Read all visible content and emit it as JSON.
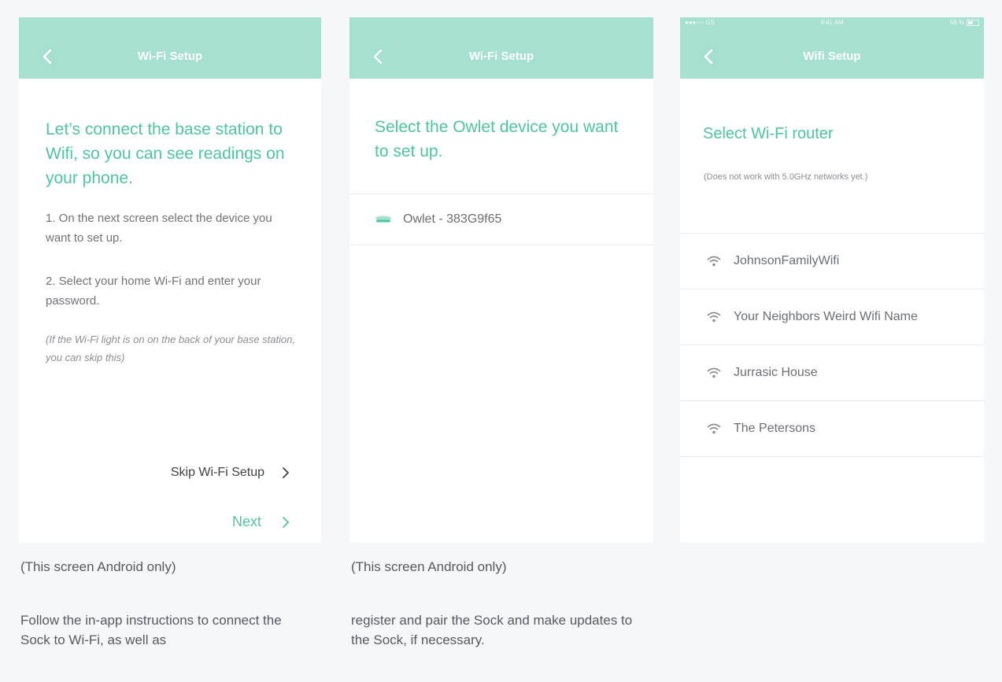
{
  "screens": [
    {
      "title": "Wi-Fi Setup",
      "heading": "Let’s connect the base station to Wifi, so you can see readings on your phone.",
      "step1": "1. On the next screen select the device you want to set up.",
      "step2": "2. Select your home Wi-Fi and enter your password.",
      "note": "(If the Wi-Fi light is on on the back of your base station, you can skip this)",
      "skip_label": "Skip Wi-Fi Setup",
      "next_label": "Next"
    },
    {
      "title": "Wi-Fi Setup",
      "heading": "Select the Owlet device you want to set up.",
      "devices": [
        "Owlet - 383G9f65"
      ]
    },
    {
      "status": {
        "carrier": "●●●○○ GS",
        "time": "9:41 AM",
        "battery": "58 %"
      },
      "title": "Wifi Setup",
      "heading": "Select Wi-Fi router",
      "subnote": "(Does not work with 5.0GHz networks yet.)",
      "networks": [
        "JohnsonFamilyWifi",
        "Your Neighbors Weird Wifi Name",
        "Jurrasic House",
        "The Petersons"
      ]
    }
  ],
  "captions": {
    "android_only_1": "(This screen Android only)",
    "android_only_2": "(This screen Android only)",
    "follow_1": "Follow the in-app instructions to connect the Sock to Wi-Fi, as well as",
    "follow_2": "register and pair the Sock and make updates to the Sock, if necessary."
  },
  "colors": {
    "accent": "#a6e1cf",
    "heading": "#4ec59f",
    "background": "#f6f7f9"
  },
  "icons": {
    "back": "chevron-left-icon",
    "forward": "chevron-right-icon",
    "wifi": "wifi-icon",
    "device": "owlet-base-icon"
  }
}
